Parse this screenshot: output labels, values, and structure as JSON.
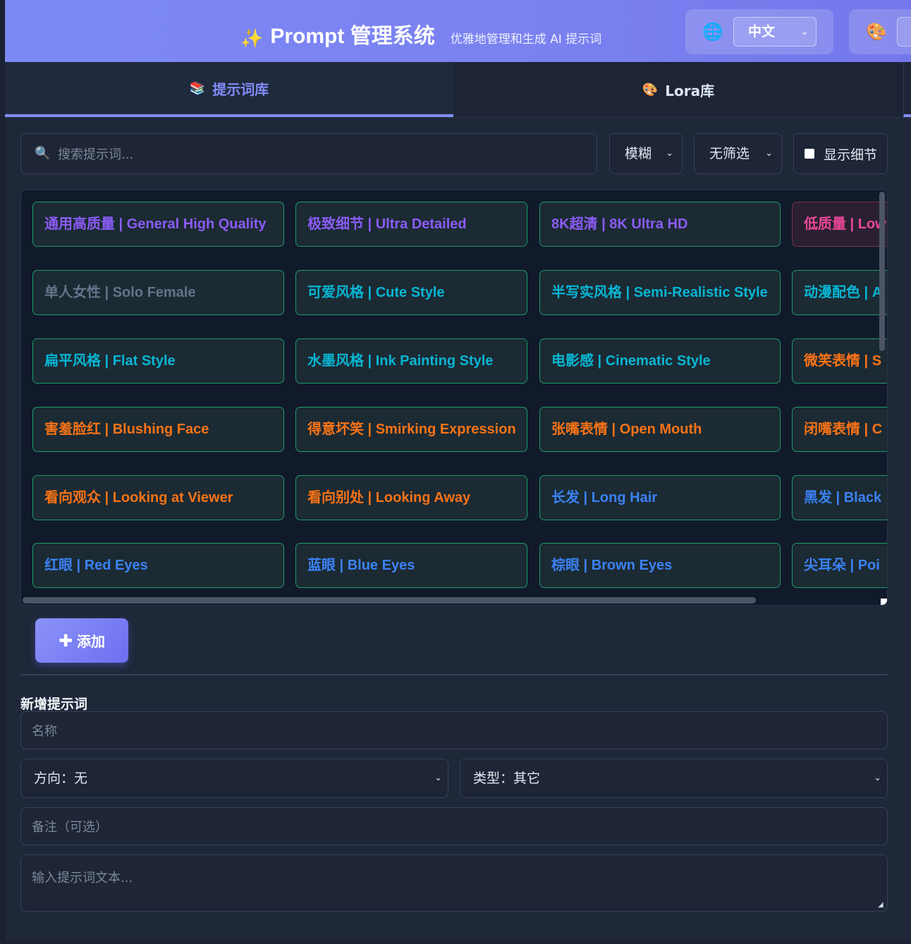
{
  "header": {
    "title": "Prompt 管理系统",
    "subtitle": "优雅地管理和生成 AI 提示词",
    "language": "中文"
  },
  "tabs": [
    {
      "label": "提示词库",
      "active": true
    },
    {
      "label": "Lora库",
      "active": false
    }
  ],
  "toolbar": {
    "search_placeholder": "搜索提示词...",
    "match_mode": "模糊",
    "filter": "无筛选",
    "show_details_label": "显示细节",
    "show_details_checked": false
  },
  "colors": {
    "accent": "#818cf8",
    "purple": "#8b5cf6",
    "cyan": "#06b6d4",
    "gray": "#64748b",
    "orange": "#f97316",
    "blue": "#3b82f6",
    "pink": "#ec4899",
    "border_green": "#1f9a6a"
  },
  "prompt_rows": [
    [
      {
        "text": "通用高质量 | General High Quality",
        "color": "#8b5cf6"
      },
      {
        "text": "极致细节 | Ultra Detailed",
        "color": "#8b5cf6"
      },
      {
        "text": "8K超清 | 8K Ultra HD",
        "color": "#8b5cf6"
      },
      {
        "text": "低质量 | Low",
        "color": "#ec4899",
        "negative": true
      }
    ],
    [
      {
        "text": "单人女性 | Solo Female",
        "color": "#64748b"
      },
      {
        "text": "可爱风格 | Cute Style",
        "color": "#06b6d4"
      },
      {
        "text": "半写实风格 | Semi-Realistic Style",
        "color": "#06b6d4"
      },
      {
        "text": "动漫配色 | A",
        "color": "#06b6d4"
      }
    ],
    [
      {
        "text": "扁平风格 | Flat Style",
        "color": "#06b6d4"
      },
      {
        "text": "水墨风格 | Ink Painting Style",
        "color": "#06b6d4"
      },
      {
        "text": "电影感 | Cinematic Style",
        "color": "#06b6d4"
      },
      {
        "text": "微笑表情 | S",
        "color": "#f97316"
      }
    ],
    [
      {
        "text": "害羞脸红 | Blushing Face",
        "color": "#f97316"
      },
      {
        "text": "得意坏笑 | Smirking Expression",
        "color": "#f97316"
      },
      {
        "text": "张嘴表情 | Open Mouth",
        "color": "#f97316"
      },
      {
        "text": "闭嘴表情 | C",
        "color": "#f97316"
      }
    ],
    [
      {
        "text": "看向观众 | Looking at Viewer",
        "color": "#f97316"
      },
      {
        "text": "看向别处 | Looking Away",
        "color": "#f97316"
      },
      {
        "text": "长发 | Long Hair",
        "color": "#3b82f6"
      },
      {
        "text": "黑发 | Black",
        "color": "#3b82f6"
      }
    ],
    [
      {
        "text": "红眼 | Red Eyes",
        "color": "#3b82f6"
      },
      {
        "text": "蓝眼 | Blue Eyes",
        "color": "#3b82f6"
      },
      {
        "text": "棕眼 | Brown Eyes",
        "color": "#3b82f6"
      },
      {
        "text": "尖耳朵 | Poi",
        "color": "#3b82f6"
      }
    ]
  ],
  "add_button": {
    "icon": "plus-icon",
    "label": "添加"
  },
  "form": {
    "title": "新增提示词",
    "name_placeholder": "名称",
    "direction": "方向：无",
    "type": "类型：其它",
    "note_placeholder": "备注（可选）",
    "text_placeholder": "输入提示词文本..."
  }
}
